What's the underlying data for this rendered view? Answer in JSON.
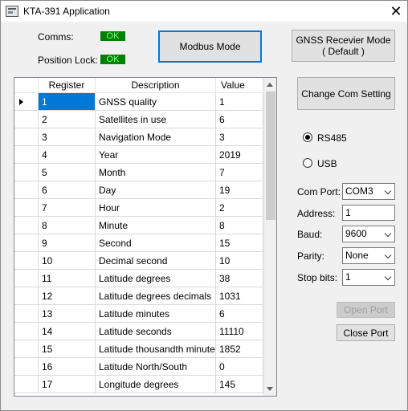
{
  "window": {
    "title": "KTA-391 Application",
    "close_glyph": "✕"
  },
  "status": {
    "comms_label": "Comms:",
    "comms_value": "OK",
    "position_lock_label": "Position Lock:",
    "position_lock_value": "OK",
    "ok_color": "#008000"
  },
  "buttons": {
    "modbus_mode": "Modbus Mode",
    "gnss_mode": "GNSS Recevier  Mode\n( Default )",
    "change_com": "Change Com Setting",
    "open_port": "Open Port",
    "close_port": "Close Port"
  },
  "grid": {
    "columns": [
      "Register",
      "Description",
      "Value"
    ],
    "rows": [
      {
        "register": "1",
        "description": "GNSS quality",
        "value": "1"
      },
      {
        "register": "2",
        "description": "Satellites in use",
        "value": "6"
      },
      {
        "register": "3",
        "description": "Navigation Mode",
        "value": "3"
      },
      {
        "register": "4",
        "description": "Year",
        "value": "2019"
      },
      {
        "register": "5",
        "description": "Month",
        "value": "7"
      },
      {
        "register": "6",
        "description": "Day",
        "value": "19"
      },
      {
        "register": "7",
        "description": "Hour",
        "value": "2"
      },
      {
        "register": "8",
        "description": "Minute",
        "value": "8"
      },
      {
        "register": "9",
        "description": "Second",
        "value": "15"
      },
      {
        "register": "10",
        "description": "Decimal second",
        "value": "10"
      },
      {
        "register": "11",
        "description": "Latitude degrees",
        "value": "38"
      },
      {
        "register": "12",
        "description": "Latitude degrees decimals",
        "value": "1031"
      },
      {
        "register": "13",
        "description": "Latitude minutes",
        "value": "6"
      },
      {
        "register": "14",
        "description": "Latitude seconds",
        "value": "11110"
      },
      {
        "register": "15",
        "description": "Latitude thousandth minutes",
        "value": "1852"
      },
      {
        "register": "16",
        "description": "Latitude North/South",
        "value": "0"
      },
      {
        "register": "17",
        "description": "Longitude degrees",
        "value": "145"
      }
    ]
  },
  "interface": {
    "rs485_label": "RS485",
    "usb_label": "USB",
    "selected": "RS485"
  },
  "settings": {
    "com_port_label": "Com Port:",
    "com_port_value": "COM3",
    "address_label": "Address:",
    "address_value": "1",
    "baud_label": "Baud:",
    "baud_value": "9600",
    "parity_label": "Parity:",
    "parity_value": "None",
    "stop_bits_label": "Stop bits:",
    "stop_bits_value": "1"
  }
}
